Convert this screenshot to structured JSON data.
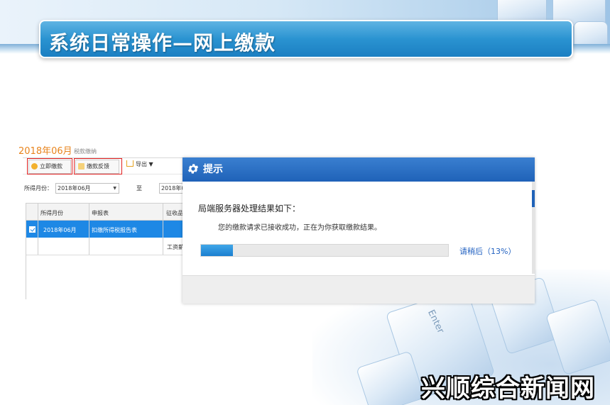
{
  "slide": {
    "title": "系统日常操作—网上缴款"
  },
  "background": {
    "key_label": "Enter"
  },
  "app": {
    "period_title": "2018年06月",
    "subtitle": "税款缴纳",
    "toolbar": {
      "pay_now_label": "立即缴款",
      "feedback_label": "缴款反馈",
      "export_label": "导出 ▼"
    },
    "filter": {
      "label": "所得月份：",
      "from_value": "2018年06月",
      "to_label": "至",
      "to_value": "2018年0"
    },
    "table": {
      "headers": [
        "所得月份",
        "申报表",
        "征收品"
      ],
      "rows": [
        {
          "month": "2018年06月",
          "form": "扣缴所得税报告表",
          "item": "",
          "selected": true
        },
        {
          "month": "",
          "form": "",
          "item": "工资薪",
          "selected": false
        }
      ]
    }
  },
  "dialog": {
    "title": "提示",
    "message_heading": "局端服务器处理结果如下：",
    "message_body": "您的缴款请求已接收成功，正在为你获取缴款结果。",
    "progress_percent": 13,
    "progress_text": "请稍后（13%）"
  },
  "watermark": "兴顺综合新闻网",
  "colors": {
    "title_bar": "#2a93d1",
    "dialog_header": "#1f62b8",
    "progress_fill": "#1b7fd0",
    "selected_row": "#1e88e5",
    "period_orange": "#e8841d",
    "highlight_red": "#e02020"
  },
  "icons": {
    "settings": "gear-icon",
    "pay_now": "coin-icon",
    "feedback": "envelope-icon",
    "export": "export-icon"
  }
}
